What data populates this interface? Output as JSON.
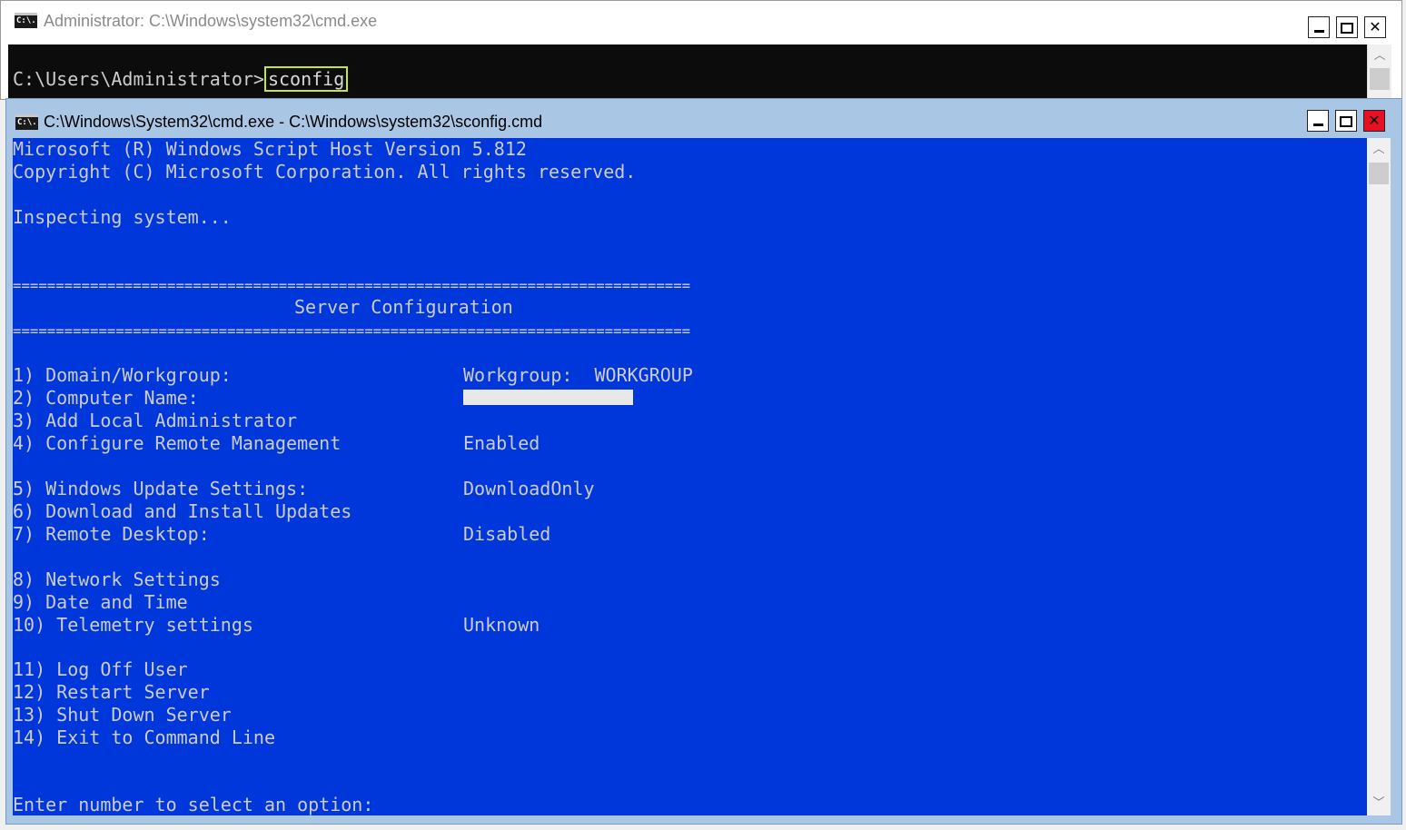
{
  "back_window": {
    "title": "Administrator: C:\\Windows\\system32\\cmd.exe",
    "icon_text": "C:\\.",
    "prompt": "C:\\Users\\Administrator>",
    "command": "sconfig"
  },
  "front_window": {
    "title": "C:\\Windows\\System32\\cmd.exe - C:\\Windows\\system32\\sconfig.cmd",
    "icon_text": "C:\\.",
    "header_lines": [
      "Microsoft (R) Windows Script Host Version 5.812",
      "Copyright (C) Microsoft Corporation. All rights reserved.",
      "Inspecting system..."
    ],
    "separator": "===============================================================================",
    "section_title": "Server Configuration",
    "menu": [
      {
        "label": "1) Domain/Workgroup:",
        "value": "Workgroup:  WORKGROUP"
      },
      {
        "label": "2) Computer Name:",
        "value": ""
      },
      {
        "label": "3) Add Local Administrator",
        "value": ""
      },
      {
        "label": "4) Configure Remote Management",
        "value": "Enabled"
      },
      {
        "label": "5) Windows Update Settings:",
        "value": "DownloadOnly"
      },
      {
        "label": "6) Download and Install Updates",
        "value": ""
      },
      {
        "label": "7) Remote Desktop:",
        "value": "Disabled"
      },
      {
        "label": "8) Network Settings",
        "value": ""
      },
      {
        "label": "9) Date and Time",
        "value": ""
      },
      {
        "label": "10) Telemetry settings",
        "value": "Unknown"
      },
      {
        "label": "11) Log Off User",
        "value": ""
      },
      {
        "label": "12) Restart Server",
        "value": ""
      },
      {
        "label": "13) Shut Down Server",
        "value": ""
      },
      {
        "label": "14) Exit to Command Line",
        "value": ""
      }
    ],
    "input_prompt": "Enter number to select an option:"
  },
  "controls": {
    "minimize": "minimize",
    "maximize": "maximize",
    "close": "✕"
  },
  "colors": {
    "console_blue": "#0037da",
    "console_black": "#0c0c0c",
    "highlight": "#c8e630",
    "close_red": "#e81123"
  }
}
